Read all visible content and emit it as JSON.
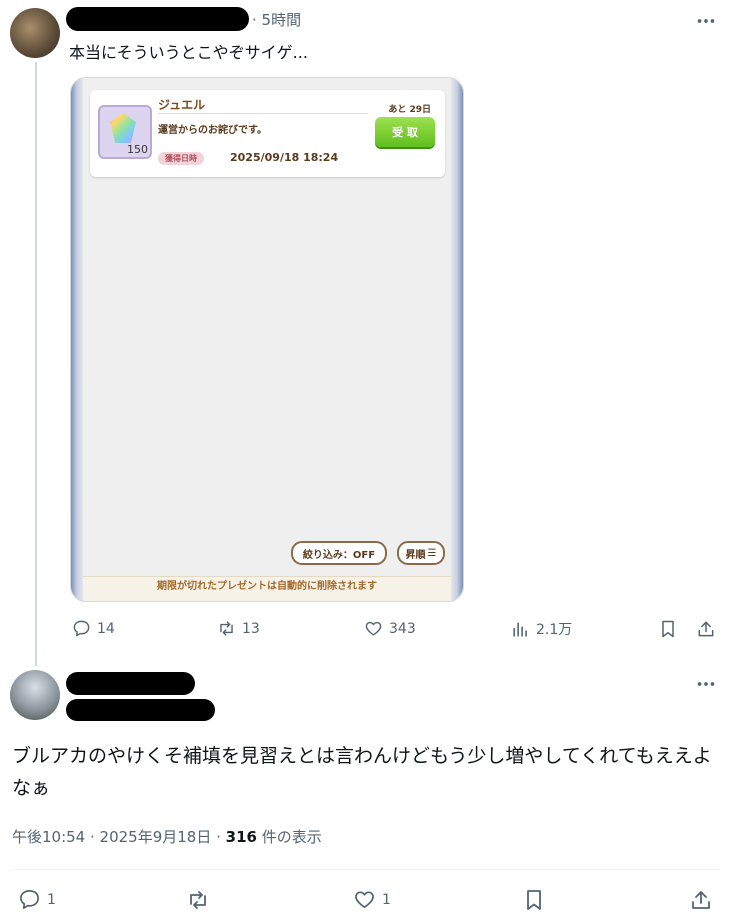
{
  "tweet1": {
    "time": "· 5時間",
    "text": "本当にそういうとこやぞサイゲ...",
    "media": {
      "gift_title": "ジュエル",
      "gift_desc": "運営からのお詫びです。",
      "jewel_count": "150",
      "date_label": "獲得日時",
      "date": "2025/09/18 18:24",
      "remaining": "あと 29日",
      "receive_label": "受 取",
      "filter_label": "絞り込み：OFF",
      "sort_label": "昇順",
      "footer_text": "期限が切れたプレゼントは自動的に削除されます"
    },
    "actions": {
      "replies": "14",
      "retweets": "13",
      "likes": "343",
      "views": "2.1万"
    }
  },
  "tweet2": {
    "text": "ブルアカのやけくそ補填を見習えとは言わんけどもう少し増やしてくれてもええよなぁ",
    "timestamp": "午後10:54 · 2025年9月18日 · ",
    "views_count": "316",
    "views_label": " 件の表示",
    "actions": {
      "replies": "1",
      "likes": "1"
    }
  },
  "icons": {
    "more": "more-dots-icon",
    "reply": "reply-icon",
    "retweet": "retweet-icon",
    "like": "heart-icon",
    "views": "views-icon",
    "bookmark": "bookmark-icon",
    "share": "share-icon"
  },
  "colors": {
    "text": "#0f1419",
    "muted": "#536471",
    "thread_line": "#cfd9de",
    "receive_green": "#5fbf1c"
  }
}
